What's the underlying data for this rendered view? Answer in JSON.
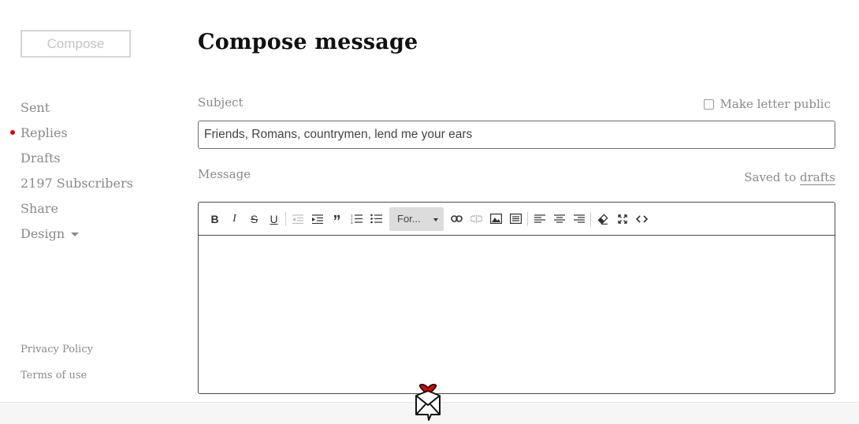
{
  "sidebar": {
    "compose_label": "Compose",
    "items": [
      {
        "label": "Sent"
      },
      {
        "label": "Replies",
        "unread": true
      },
      {
        "label": "Drafts"
      },
      {
        "label": "2197 Subscribers"
      },
      {
        "label": "Share"
      },
      {
        "label": "Design",
        "has_dropdown": true
      }
    ],
    "footer": [
      {
        "label": "Privacy Policy"
      },
      {
        "label": "Terms of use"
      }
    ]
  },
  "main": {
    "title": "Compose message",
    "subject_label": "Subject",
    "make_public_label": "Make letter public",
    "make_public_checked": false,
    "subject_value": "Friends, Romans, countrymen, lend me your ears",
    "message_label": "Message",
    "saved_prefix": "Saved to",
    "saved_link": "drafts",
    "toolbar": {
      "format_select": "For...",
      "buttons": [
        "bold",
        "italic",
        "strikethrough",
        "underline",
        "outdent",
        "indent",
        "blockquote",
        "ordered-list",
        "unordered-list",
        "link",
        "unlink",
        "image",
        "horizontal-rule",
        "align-left",
        "align-center",
        "align-right",
        "clear-formatting",
        "fullscreen",
        "code-view"
      ]
    },
    "message_value": ""
  },
  "colors": {
    "unread_dot": "#e00000",
    "muted_text": "#8a8a8a",
    "logo_heart": "#e00000"
  }
}
